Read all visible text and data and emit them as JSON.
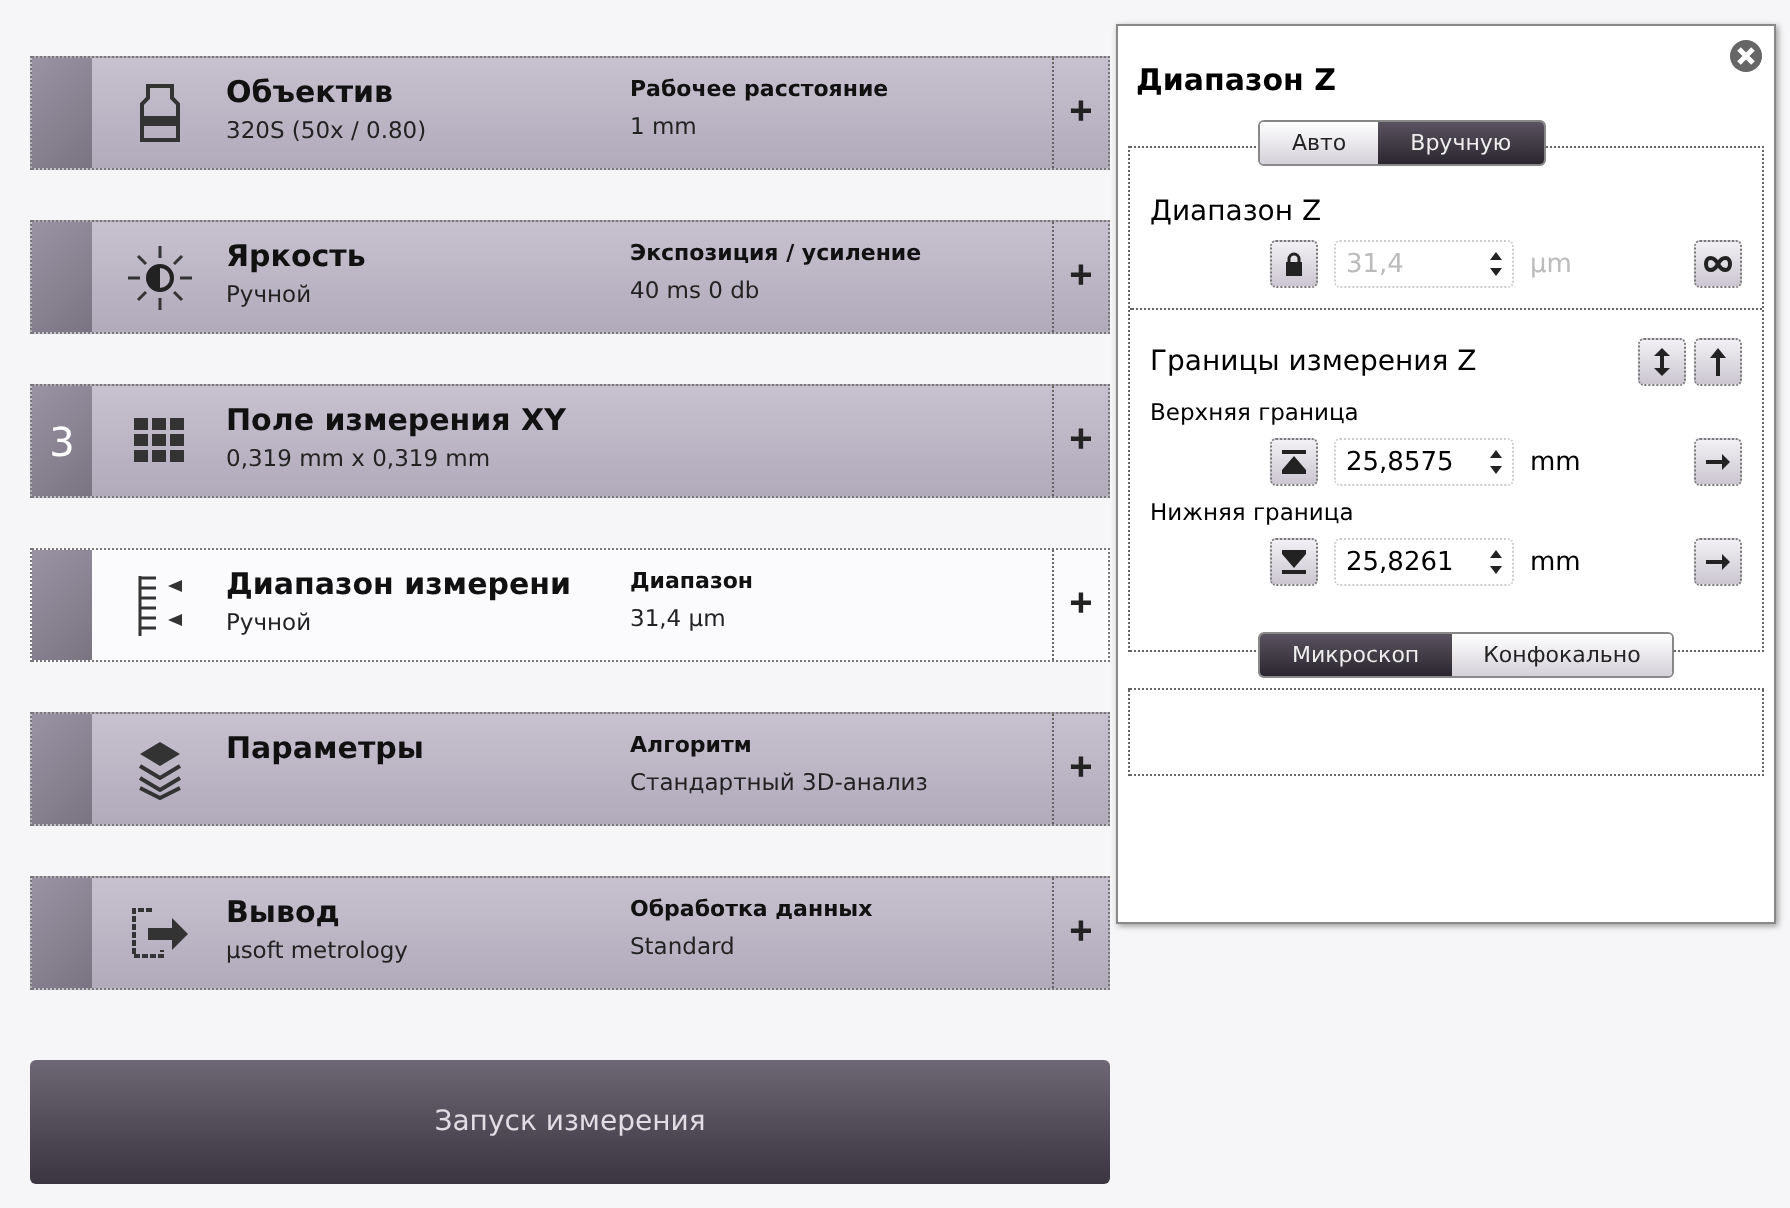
{
  "steps": [
    {
      "kind": "objective",
      "title": "Объектив",
      "subtitle": "320S (50x / 0.80)",
      "param_label": "Рабочее расстояние",
      "param_value": "1 mm",
      "selected": false
    },
    {
      "kind": "brightness",
      "title": "Яркость",
      "subtitle": "Ручной",
      "param_label": "Экспозиция / усиление",
      "param_value": "40 ms   0 db",
      "selected": false
    },
    {
      "kind": "grid",
      "step": "3",
      "title": "Поле измерения XY",
      "subtitle": "0,319 mm x 0,319 mm",
      "selected": false
    },
    {
      "kind": "range",
      "title": "Диапазон измерени",
      "subtitle": "Ручной",
      "param_label": "Диапазон",
      "param_value": "31,4 µm",
      "selected": true
    },
    {
      "kind": "layers",
      "title": "Параметры",
      "param_label": "Алгоритм",
      "param_value": "Стандартный 3D-анализ",
      "selected": false
    },
    {
      "kind": "output",
      "title": "Вывод",
      "subtitle": "µsoft metrology",
      "param_label": "Обработка данных",
      "param_value": "Standard",
      "selected": false
    }
  ],
  "expand_symbol": "+",
  "start_button": "Запуск измерения",
  "panel": {
    "title": "Диапазон Z",
    "mode_tabs": [
      {
        "label": "Авто",
        "selected": false
      },
      {
        "label": "Вручную",
        "selected": true
      }
    ],
    "range": {
      "title": "Диапазон Z",
      "value": "31,4",
      "unit": "µm",
      "disabled": true
    },
    "bounds": {
      "title": "Границы измерения Z",
      "rows": [
        {
          "kind": "upper",
          "label": "Верхняя граница",
          "value": "25,8575",
          "unit": "mm"
        },
        {
          "kind": "lower",
          "label": "Нижняя граница",
          "value": "25,8261",
          "unit": "mm"
        }
      ]
    },
    "view_tabs": [
      {
        "label": "Микроскоп",
        "selected": true
      },
      {
        "label": "Конфокально",
        "selected": false
      }
    ]
  }
}
